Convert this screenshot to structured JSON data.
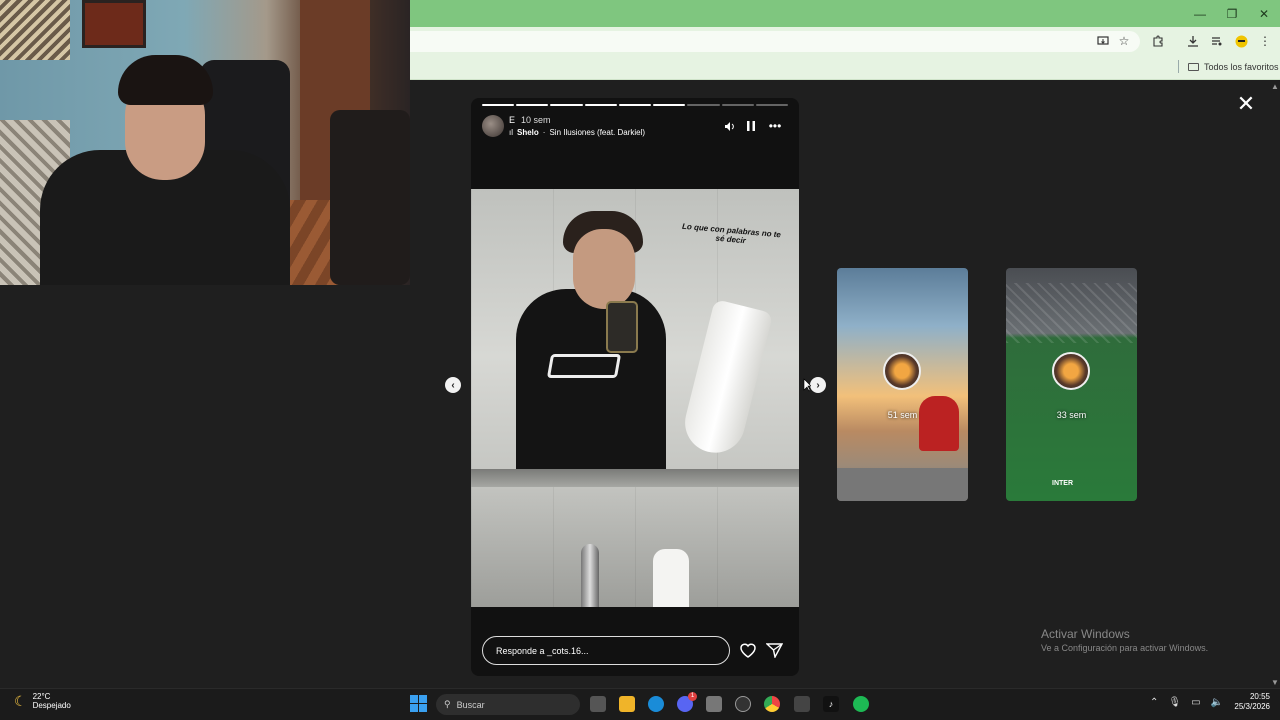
{
  "browser": {
    "window_controls": {
      "minimize": "—",
      "restore": "❐",
      "close": "✕"
    },
    "bookmarks_label": "Todos los favoritos"
  },
  "story": {
    "username": "E",
    "time_ago": "10 sem",
    "music": {
      "artist": "Shelo",
      "song": "Sin Ilusiones (feat. Darkiel)",
      "separator": "·"
    },
    "progress": {
      "segments": 9,
      "completed": 6
    },
    "caption": "Lo que con palabras no te sé decir",
    "reply_placeholder": "Responde a _cots.16..."
  },
  "previews": [
    {
      "time_ago": "51 sem"
    },
    {
      "time_ago": "33 sem",
      "badge": "INTER"
    }
  ],
  "activation": {
    "title": "Activar Windows",
    "subtitle": "Ve a Configuración para activar Windows."
  },
  "taskbar": {
    "weather": {
      "temp": "22°C",
      "condition": "Despejado"
    },
    "search_placeholder": "Buscar",
    "notification_count": "1",
    "clock": {
      "time": "20:55",
      "date": "25/3/2026"
    }
  },
  "colors": {
    "titlebar": "#7fc67f",
    "toolbar": "#e6f3e2",
    "page_bg": "#1f1f1f",
    "taskbar": "#1b1b1b",
    "win_blue": "#3aa0f0"
  }
}
